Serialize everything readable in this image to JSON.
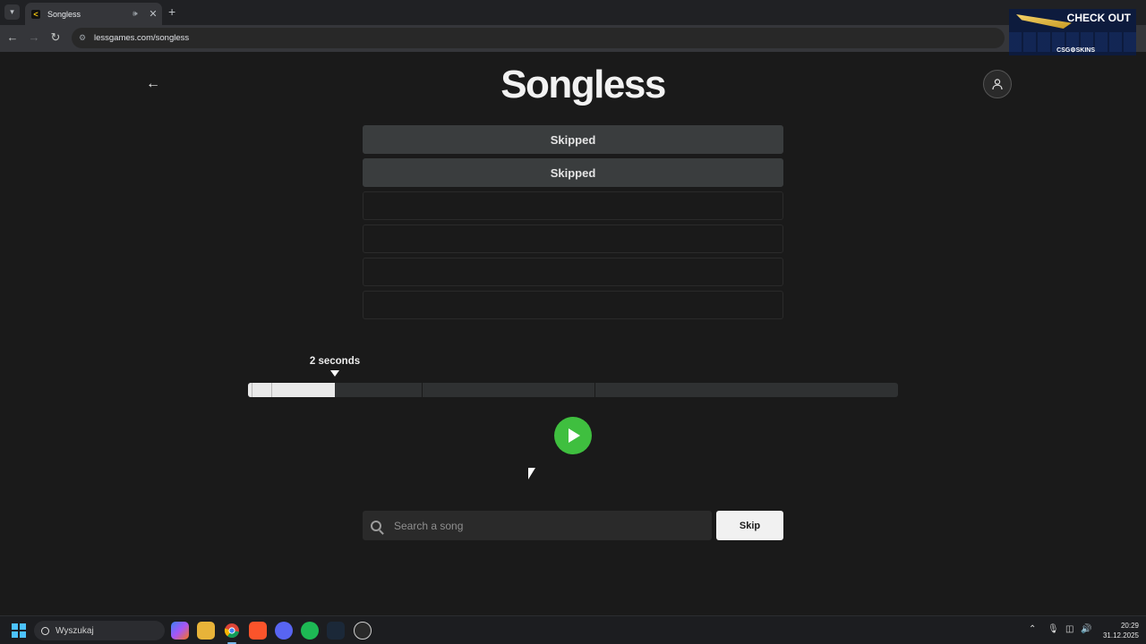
{
  "browser": {
    "tab_title": "Songless",
    "url": "lessgames.com/songless",
    "ad_text": "CHECK OUT",
    "ad_brand": "CSG⚙SKINS"
  },
  "page": {
    "logo": "Songless",
    "guesses": [
      "Skipped",
      "Skipped",
      "",
      "",
      "",
      ""
    ],
    "clip_length_label": "2 seconds",
    "clip_progress_fraction": 0.134,
    "search_placeholder": "Search a song",
    "search_value": "",
    "skip_label": "Skip"
  },
  "taskbar": {
    "search_label": "Wyszukaj",
    "time": "20:29",
    "date": "31.12.2025"
  },
  "colors": {
    "page_bg": "#1a1a1a",
    "play_green": "#3fbf3f",
    "filled_row": "#3a3d3e"
  },
  "icons": {
    "back": "arrow-left-icon",
    "profile": "user-icon",
    "play": "play-icon",
    "search": "search-icon"
  }
}
